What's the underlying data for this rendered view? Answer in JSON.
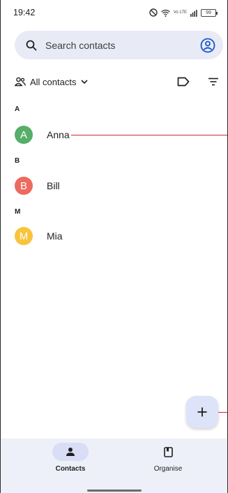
{
  "status_bar": {
    "time": "19:42",
    "network_label": "Vo LTE",
    "battery": "99",
    "icons": [
      "dnd-icon",
      "wifi-icon",
      "signal-icon",
      "battery-icon"
    ]
  },
  "search": {
    "placeholder": "Search contacts",
    "icon": "search-icon",
    "account_icon": "account-circle-icon"
  },
  "filter": {
    "label": "All contacts",
    "icons": [
      "people-icon",
      "chevron-down-icon",
      "label-icon",
      "filter-icon"
    ]
  },
  "sections": [
    {
      "header": "A",
      "contacts": [
        {
          "name": "Anna",
          "initial": "A",
          "color": "#57ae68"
        }
      ]
    },
    {
      "header": "B",
      "contacts": [
        {
          "name": "Bill",
          "initial": "B",
          "color": "#ec6a5e"
        }
      ]
    },
    {
      "header": "M",
      "contacts": [
        {
          "name": "Mia",
          "initial": "M",
          "color": "#f8c43c"
        }
      ]
    }
  ],
  "fab": {
    "icon": "plus-icon"
  },
  "bottom_nav": {
    "items": [
      {
        "label": "Contacts",
        "icon": "person-icon",
        "active": true
      },
      {
        "label": "Organise",
        "icon": "bookmark-icon",
        "active": false
      }
    ]
  },
  "colors": {
    "search_bg": "#e8ebf6",
    "nav_bg": "#edf0f8",
    "nav_active_pill": "#d9def6",
    "fab_bg": "#dde3f8",
    "annotation_red": "#d3232f"
  }
}
